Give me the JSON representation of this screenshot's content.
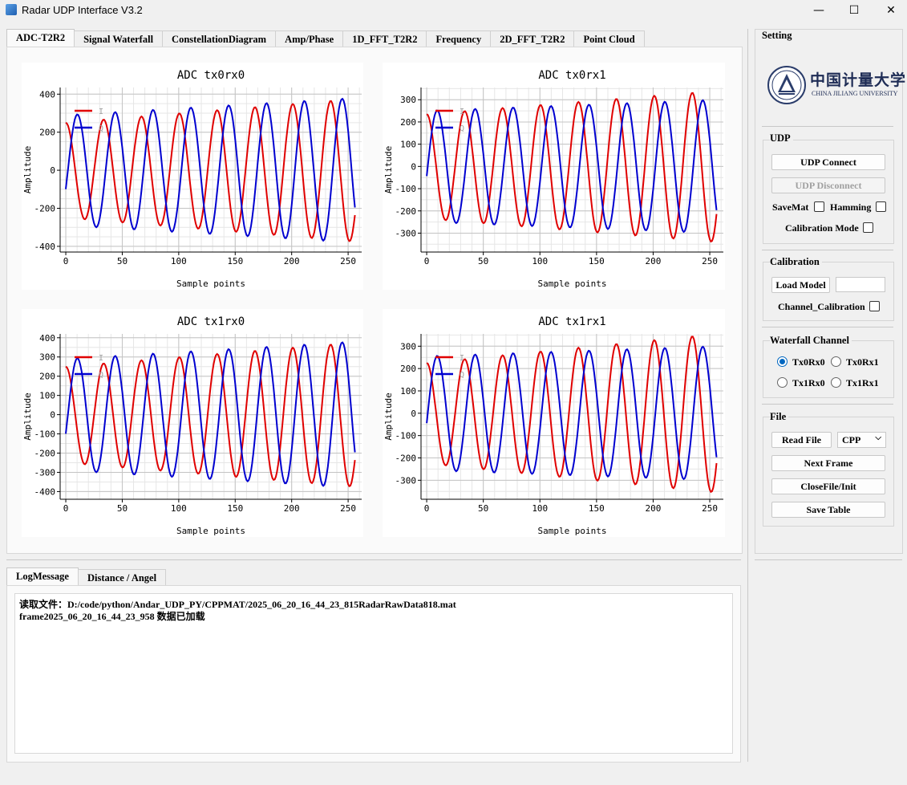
{
  "window": {
    "title": "Radar UDP Interface V3.2",
    "minimize": "—",
    "maximize": "☐",
    "close": "✕"
  },
  "main_tabs": [
    {
      "label": "ADC-T2R2",
      "active": true
    },
    {
      "label": "Signal Waterfall"
    },
    {
      "label": "ConstellationDiagram"
    },
    {
      "label": "Amp/Phase"
    },
    {
      "label": "1D_FFT_T2R2"
    },
    {
      "label": "Frequency"
    },
    {
      "label": "2D_FFT_T2R2"
    },
    {
      "label": "Point Cloud"
    }
  ],
  "plot_common": {
    "xlabel": "Sample points",
    "ylabel": "Amplitude",
    "legend": [
      "I",
      "Q"
    ],
    "colors": {
      "I": "#e00000",
      "Q": "#0000d0"
    }
  },
  "chart_data": [
    {
      "type": "line",
      "title": "ADC tx0rx0",
      "xlabel": "Sample points",
      "ylabel": "Amplitude",
      "xlim": [
        -5,
        262
      ],
      "ylim": [
        -430,
        435
      ],
      "xticks": [
        0,
        50,
        100,
        150,
        200,
        250
      ],
      "yticks": [
        -400,
        -200,
        0,
        200,
        400
      ],
      "series": [
        {
          "name": "I",
          "amp_start": 250,
          "amp_end": 375,
          "phase_deg": 90,
          "period": 33.5
        },
        {
          "name": "Q",
          "amp_start": 290,
          "amp_end": 380,
          "phase_deg": -20,
          "period": 33.5
        }
      ]
    },
    {
      "type": "line",
      "title": "ADC tx0rx1",
      "xlabel": "Sample points",
      "ylabel": "Amplitude",
      "xlim": [
        -5,
        262
      ],
      "ylim": [
        -385,
        355
      ],
      "xticks": [
        0,
        50,
        100,
        150,
        200,
        250
      ],
      "yticks": [
        -300,
        -200,
        -100,
        0,
        100,
        200,
        300
      ],
      "series": [
        {
          "name": "I",
          "amp_start": 235,
          "amp_end": 340,
          "phase_deg": 90,
          "period": 33.5
        },
        {
          "name": "Q",
          "amp_start": 250,
          "amp_end": 300,
          "phase_deg": -10,
          "period": 33.5
        }
      ]
    },
    {
      "type": "line",
      "title": "ADC tx1rx0",
      "xlabel": "Sample points",
      "ylabel": "Amplitude",
      "xlim": [
        -5,
        262
      ],
      "ylim": [
        -440,
        420
      ],
      "xticks": [
        0,
        50,
        100,
        150,
        200,
        250
      ],
      "yticks": [
        -400,
        -300,
        -200,
        -100,
        0,
        100,
        200,
        300,
        400
      ],
      "series": [
        {
          "name": "I",
          "amp_start": 250,
          "amp_end": 375,
          "phase_deg": 90,
          "period": 33.5
        },
        {
          "name": "Q",
          "amp_start": 290,
          "amp_end": 380,
          "phase_deg": -20,
          "period": 33.5
        }
      ]
    },
    {
      "type": "line",
      "title": "ADC tx1rx1",
      "xlabel": "Sample points",
      "ylabel": "Amplitude",
      "xlim": [
        -5,
        262
      ],
      "ylim": [
        -385,
        355
      ],
      "xticks": [
        0,
        50,
        100,
        150,
        200,
        250
      ],
      "yticks": [
        -300,
        -200,
        -100,
        0,
        100,
        200,
        300
      ],
      "series": [
        {
          "name": "I",
          "amp_start": 225,
          "amp_end": 355,
          "phase_deg": 90,
          "period": 33.5
        },
        {
          "name": "Q",
          "amp_start": 255,
          "amp_end": 300,
          "phase_deg": -10,
          "period": 33.5
        }
      ]
    }
  ],
  "sidebar": {
    "title": "Setting",
    "logo": {
      "cn": "中国计量大学",
      "en": "CHINA JILIANG UNIVERSITY"
    },
    "udp": {
      "title": "UDP",
      "connect": "UDP Connect",
      "disconnect": "UDP Disconnect",
      "savemat": "SaveMat",
      "hamming": "Hamming",
      "calibration_mode": "Calibration Mode"
    },
    "calibration": {
      "title": "Calibration",
      "load_model": "Load Model",
      "channel_calibration": "Channel_Calibration"
    },
    "waterfall": {
      "title": "Waterfall Channel",
      "options": [
        "Tx0Rx0",
        "Tx0Rx1",
        "Tx1Rx0",
        "Tx1Rx1"
      ],
      "selected": "Tx0Rx0"
    },
    "file": {
      "title": "File",
      "read_file": "Read File",
      "format": "CPP",
      "next_frame": "Next Frame",
      "close_init": "CloseFile/Init",
      "save_table": "Save Table"
    }
  },
  "bottom_tabs": [
    {
      "label": "LogMessage",
      "active": true
    },
    {
      "label": "Distance / Angel"
    }
  ],
  "log": {
    "lines": [
      "读取文件：D:/code/python/Andar_UDP_PY/CPPMAT/2025_06_20_16_44_23_815RadarRawData818.mat",
      "frame2025_06_20_16_44_23_958 数据已加载"
    ]
  }
}
